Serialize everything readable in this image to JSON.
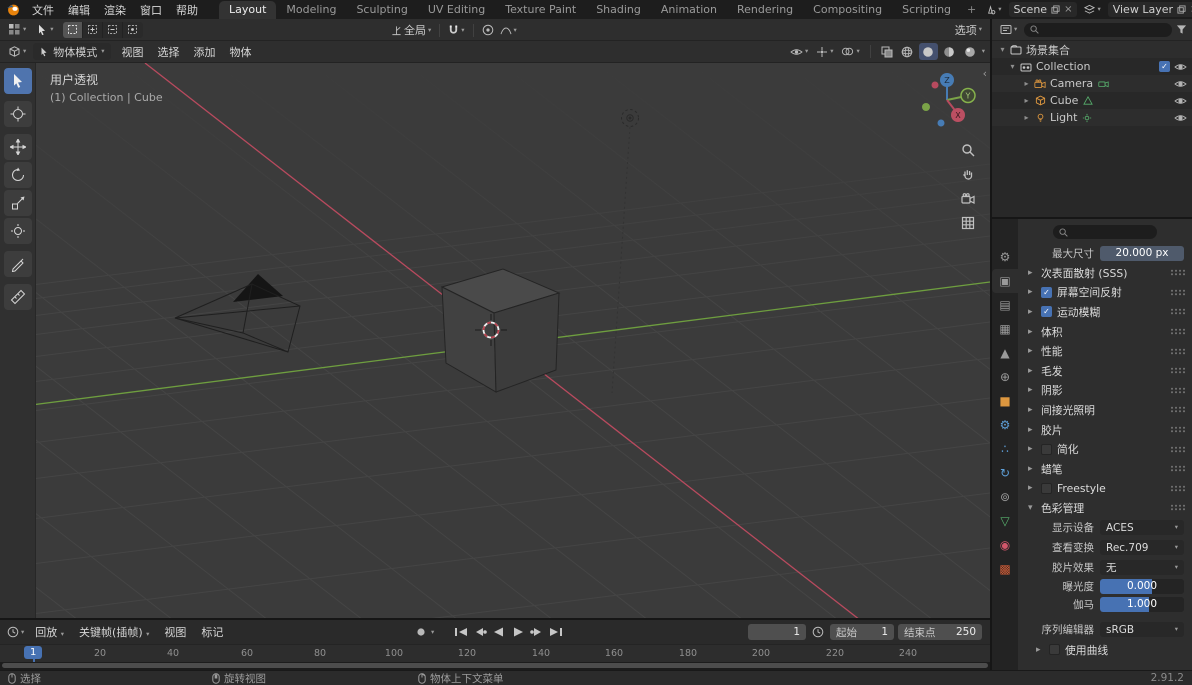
{
  "colors": {
    "accent_blue": "#4772b3",
    "active_tool_blue": "#4f74ae",
    "axis_x_red": "#b84a5e",
    "axis_y_green": "#6e9e3f",
    "axis_z_blue": "#477cb5",
    "object_orange": "#dd973f",
    "data_green": "#58b26e"
  },
  "topbar": {
    "menus": [
      "文件",
      "编辑",
      "渲染",
      "窗口",
      "帮助"
    ],
    "tabs": [
      "Layout",
      "Modeling",
      "Sculpting",
      "UV Editing",
      "Texture Paint",
      "Shading",
      "Animation",
      "Rendering",
      "Compositing",
      "Scripting"
    ],
    "add_tab": "+",
    "active_tab": "Layout",
    "scene": "Scene",
    "view_layer": "View Layer"
  },
  "tool_settings": {
    "orientation": "全局",
    "options": "选项"
  },
  "header": {
    "mode": "物体模式",
    "menus": [
      "视图",
      "选择",
      "添加",
      "物体"
    ]
  },
  "viewport": {
    "view_label": "用户透视",
    "context_label": "(1) Collection | Cube",
    "axis_x": "X",
    "axis_y": "Y",
    "axis_z": "Z"
  },
  "outliner": {
    "root": "场景集合",
    "collection": "Collection",
    "children": [
      "Camera",
      "Cube",
      "Light"
    ]
  },
  "prop_tabs": [
    {
      "name": "tool",
      "glyph": "⚙"
    },
    {
      "name": "render",
      "glyph": "▣"
    },
    {
      "name": "output",
      "glyph": "▤"
    },
    {
      "name": "view-layer",
      "glyph": "▦"
    },
    {
      "name": "scene",
      "glyph": "▲"
    },
    {
      "name": "world",
      "glyph": "⊕"
    },
    {
      "name": "object",
      "glyph": "■"
    },
    {
      "name": "modifiers",
      "glyph": "⚙"
    },
    {
      "name": "particles",
      "glyph": "∴"
    },
    {
      "name": "physics",
      "glyph": "↻"
    },
    {
      "name": "constraints",
      "glyph": "⊚"
    },
    {
      "name": "object-data",
      "glyph": "▽"
    },
    {
      "name": "material",
      "glyph": "◉"
    },
    {
      "name": "texture",
      "glyph": "▩"
    }
  ],
  "properties": {
    "max_size_label": "最大尺寸",
    "max_size_value": "20.000 px",
    "sections": [
      {
        "arrow": "▸",
        "label": "次表面散射 (SSS)"
      },
      {
        "arrow": "▸",
        "label": "屏幕空间反射",
        "checked": true
      },
      {
        "arrow": "▸",
        "label": "运动模糊",
        "checked": true
      },
      {
        "arrow": "▸",
        "label": "体积"
      },
      {
        "arrow": "▸",
        "label": "性能"
      },
      {
        "arrow": "▸",
        "label": "毛发"
      },
      {
        "arrow": "▸",
        "label": "阴影"
      },
      {
        "arrow": "▸",
        "label": "间接光照明"
      },
      {
        "arrow": "▸",
        "label": "胶片"
      },
      {
        "arrow": "▸",
        "label": "简化",
        "checked": false
      },
      {
        "arrow": "▸",
        "label": "蜡笔"
      },
      {
        "arrow": "▸",
        "label": "Freestyle",
        "checked": false
      },
      {
        "arrow": "▾",
        "label": "色彩管理"
      }
    ],
    "color_management": {
      "display_device_label": "显示设备",
      "display_device": "ACES",
      "view_transform_label": "查看变换",
      "view_transform": "Rec.709",
      "look_label": "胶片效果",
      "look": "无",
      "exposure_label": "曝光度",
      "exposure": "0.000",
      "gamma_label": "伽马",
      "gamma": "1.000",
      "sequencer_label": "序列编辑器",
      "sequencer": "sRGB",
      "use_curves_arrow": "▸",
      "use_curves_label": "使用曲线"
    }
  },
  "timeline": {
    "menus": [
      "回放",
      "关键帧(插帧)",
      "视图",
      "标记"
    ],
    "playhead": "1",
    "current_frame": "1",
    "start_label": "起始",
    "start_value": "1",
    "end_label": "结束点",
    "end_value": "250",
    "ticks": [
      "20",
      "40",
      "60",
      "80",
      "100",
      "120",
      "140",
      "160",
      "180",
      "200",
      "220",
      "240"
    ]
  },
  "statusbar": {
    "select": "选择",
    "rotate": "旋转视图",
    "context_menu": "物体上下文菜单",
    "version": "2.91.2"
  }
}
